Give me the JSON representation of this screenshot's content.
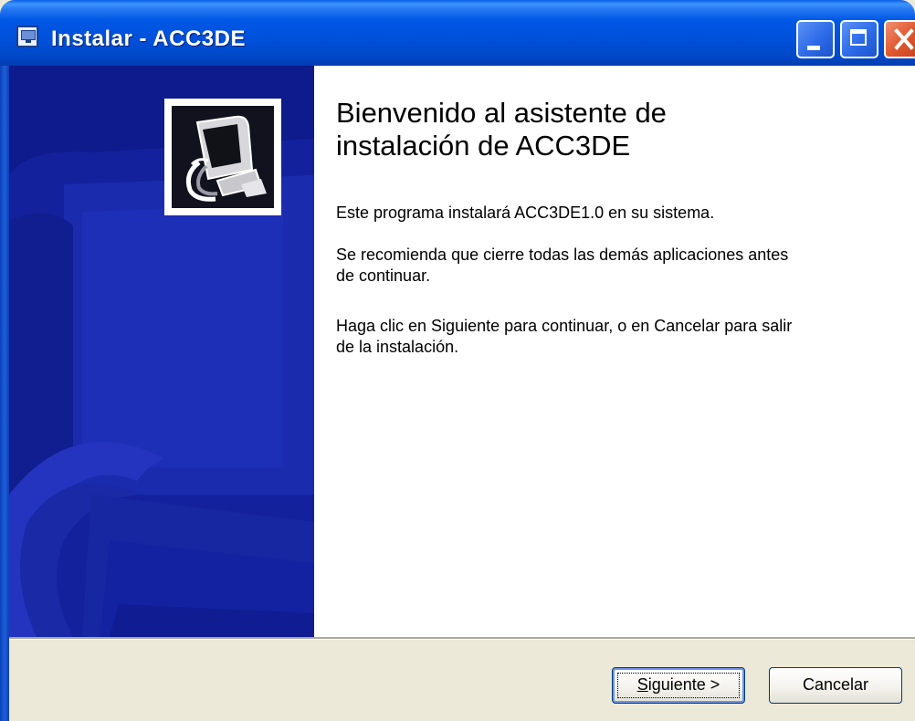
{
  "window": {
    "title": "Instalar - ACC3DE",
    "icon": "installer-app-icon",
    "controls": [
      "minimize-icon",
      "maximize-icon",
      "close-icon"
    ]
  },
  "banner": {
    "logo_icon": "computer-setup-icon"
  },
  "welcome": {
    "title_line1": "Bienvenido al asistente de",
    "title_line2": "instalación de ACC3DE",
    "paragraph1": "Este programa instalará ACC3DE1.0 en su sistema.",
    "paragraph2_line1": "Se recomienda que cierre todas las demás aplicaciones antes",
    "paragraph2_line2": "de continuar.",
    "paragraph3_line1": "Haga clic en Siguiente para continuar, o en Cancelar para salir",
    "paragraph3_line2": "de la instalación."
  },
  "buttons": {
    "next_accel": "S",
    "next_rest": "iguiente >",
    "cancel": "Cancelar"
  },
  "colors": {
    "titlebar": "#0058E6",
    "banner": "#0E1B8C",
    "dialog_face": "#ECE9D8",
    "close_button": "#E0582E"
  }
}
